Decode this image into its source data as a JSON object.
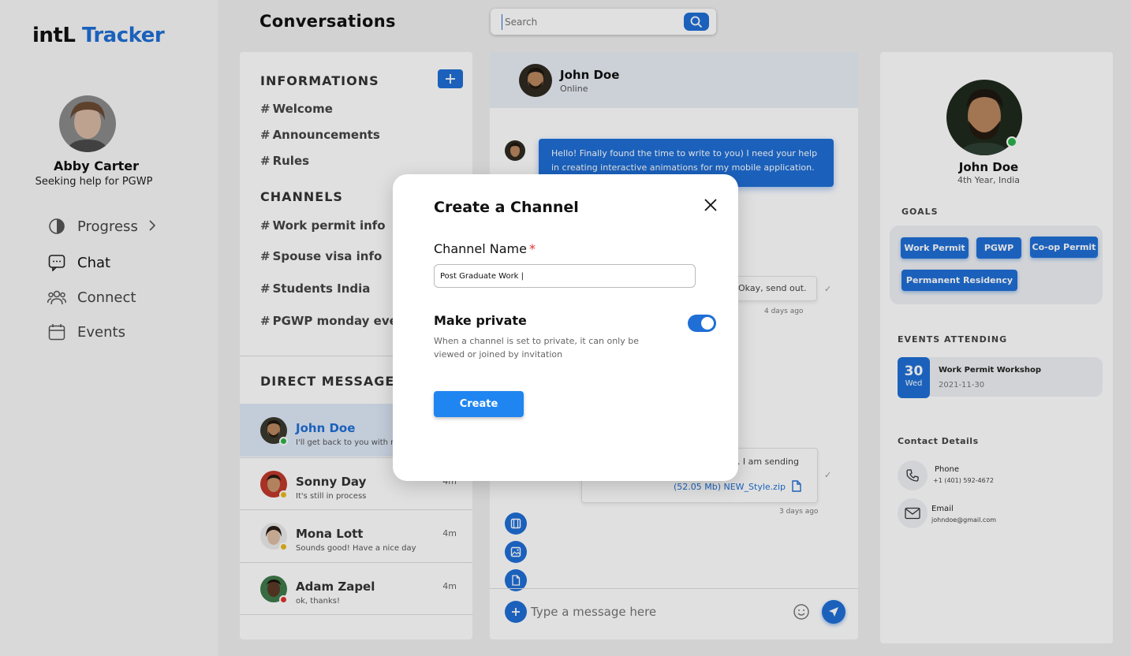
{
  "app": {
    "logo_main": "intL",
    "logo_accent": "Tracker"
  },
  "user": {
    "name": "Abby Carter",
    "subtitle": "Seeking help for PGWP"
  },
  "nav": [
    {
      "label": "Progress",
      "icon": "pie-chart-icon"
    },
    {
      "label": "Chat",
      "icon": "chat-icon"
    },
    {
      "label": "Connect",
      "icon": "people-icon"
    },
    {
      "label": "Events",
      "icon": "calendar-icon"
    }
  ],
  "header": {
    "title": "Conversations",
    "search_placeholder": "Search"
  },
  "channels_panel": {
    "info_title": "INFORMATIONS",
    "info_items": [
      "Welcome",
      "Announcements",
      "Rules"
    ],
    "channels_title": "CHANNELS",
    "channel_items": [
      "Work permit info",
      "Spouse visa info",
      "Students India",
      "PGWP monday event"
    ],
    "dm_title": "DIRECT MESSAGES",
    "dms": [
      {
        "name": "John Doe",
        "message": "I'll get back to you with more",
        "time": "",
        "status_color": "#2bb24c"
      },
      {
        "name": "Sonny Day",
        "message": "It's still in process",
        "time": "4m",
        "status_color": "#e8b91c"
      },
      {
        "name": "Mona Lott",
        "message": "Sounds good! Have a nice day",
        "time": "4m",
        "status_color": "#e8b91c"
      },
      {
        "name": "Adam Zapel",
        "message": "ok, thanks!",
        "time": "4m",
        "status_color": "#e0312e"
      }
    ]
  },
  "chat": {
    "contact_name": "John Doe",
    "contact_status": "Online",
    "msg1": "Hello! Finally found the time to write to you) I need your help in creating interactive animations for my mobile application.",
    "msg2": "Okay, send out.",
    "msg2_time": "4 days ago",
    "msg3": "d. I am sending",
    "msg3_file": "(52.05 Mb) NEW_Style.zip",
    "msg3_time": "3 days ago",
    "input_placeholder": "Type a message here"
  },
  "profile": {
    "name": "John Doe",
    "subtitle": "4th Year, India",
    "goals_title": "GOALS",
    "goals": [
      "Work Permit",
      "PGWP",
      "Co-op Permit",
      "Permanent Residency"
    ],
    "events_title": "EVENTS ATTENDING",
    "event": {
      "day": "30",
      "weekday": "Wed",
      "title": "Work Permit Workshop",
      "date": "2021-11-30"
    },
    "contact_title": "Contact Details",
    "phone_label": "Phone",
    "phone_value": "+1 (401) 592-4672",
    "email_label": "Email",
    "email_value": "johndoe@gmail.com"
  },
  "modal": {
    "title": "Create a Channel",
    "name_label": "Channel Name",
    "required_mark": "*",
    "name_value": "Post Graduate Work |",
    "private_title": "Make private",
    "private_desc": "When a channel is set to private, it can only be viewed or joined by invitation",
    "private_enabled": true,
    "create_label": "Create"
  },
  "colors": {
    "accent": "#1f6fd6",
    "button": "#1f85f0",
    "online": "#2bb24c",
    "away": "#e8b91c",
    "busy": "#e0312e"
  }
}
